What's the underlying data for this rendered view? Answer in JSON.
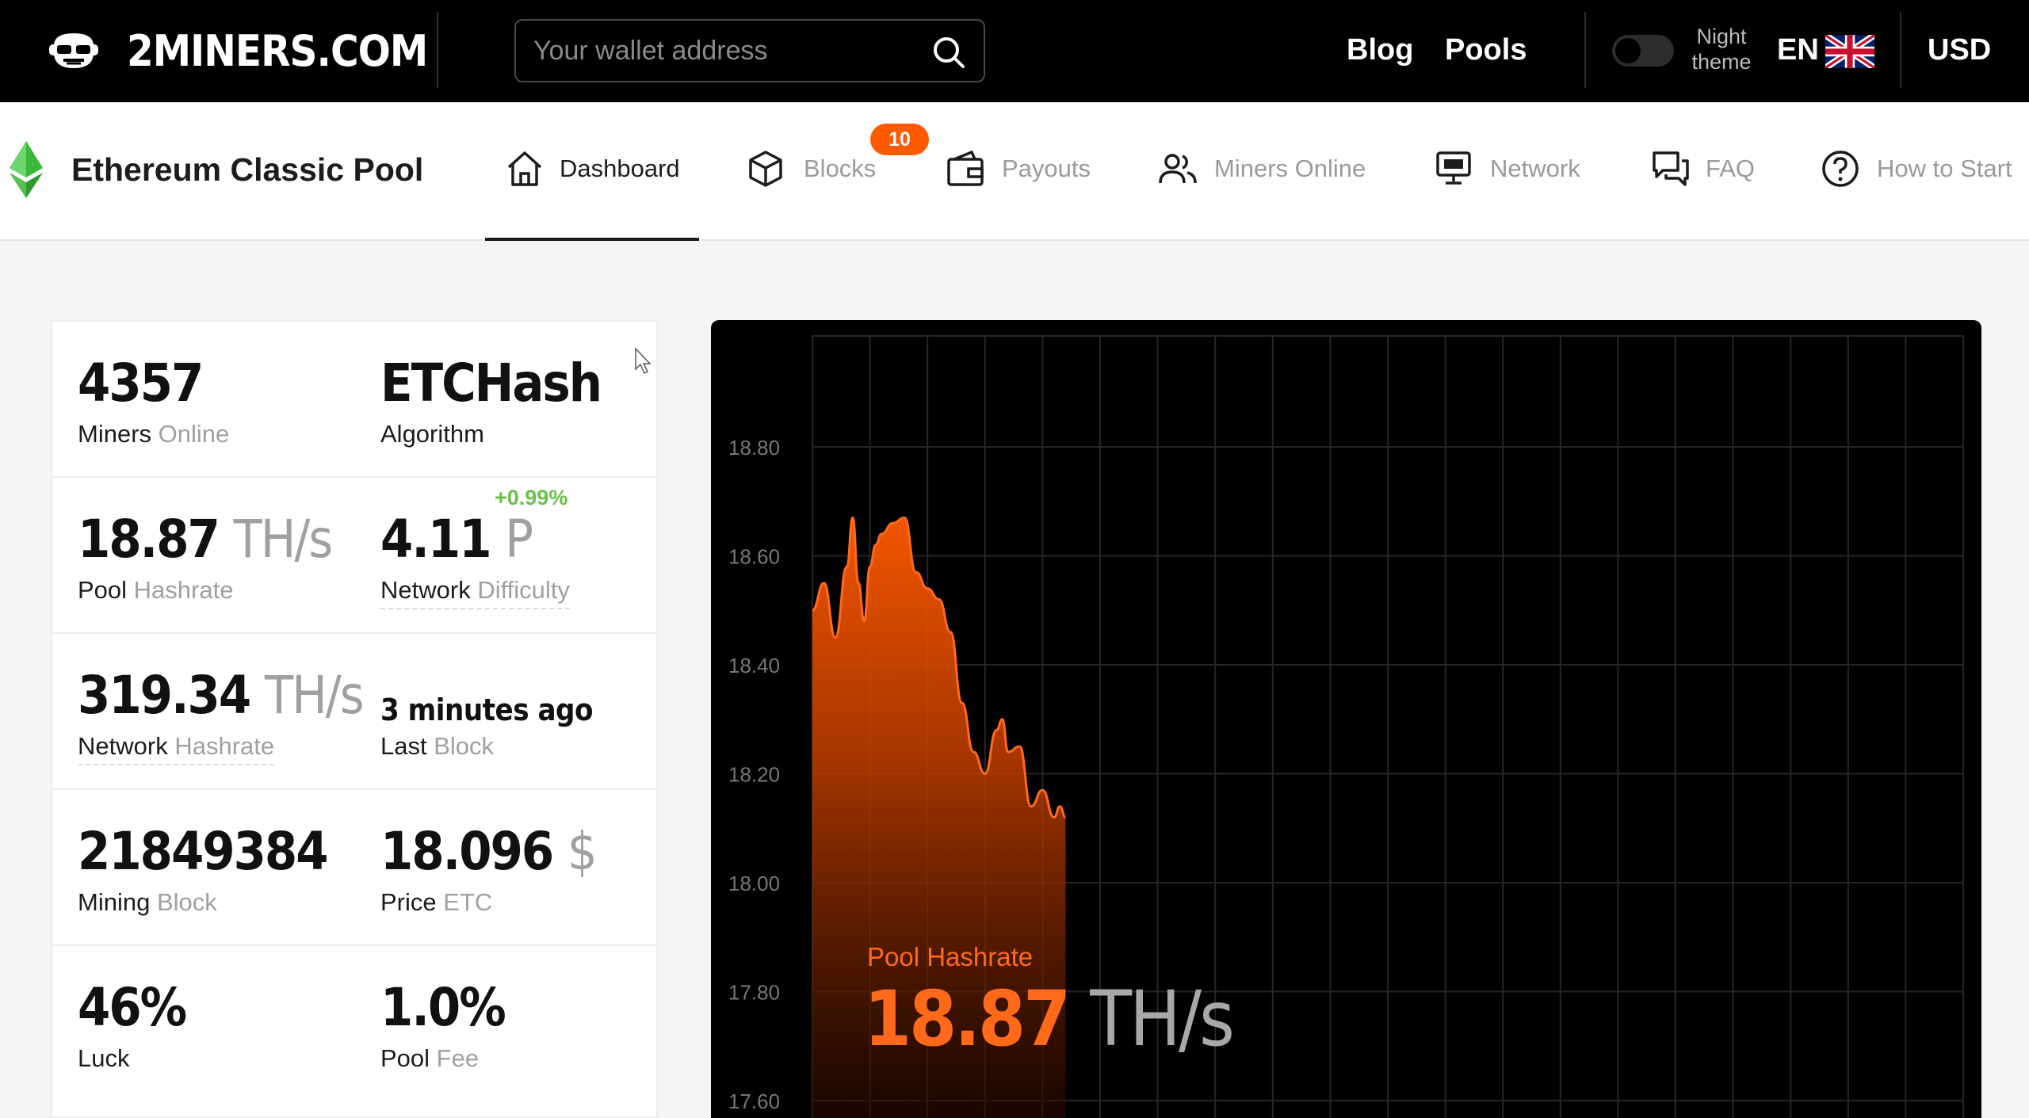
{
  "header": {
    "logo_text": "2MINERS.COM",
    "search": {
      "placeholder": "Your wallet address"
    },
    "links": [
      {
        "label": "Blog"
      },
      {
        "label": "Pools"
      }
    ],
    "night_theme": {
      "line1": "Night",
      "line2": "theme",
      "enabled": false
    },
    "language": "EN",
    "currency": "USD"
  },
  "subnav": {
    "pool_title": "Ethereum Classic Pool",
    "tabs": [
      {
        "label": "Dashboard",
        "icon": "home-icon",
        "active": true
      },
      {
        "label": "Blocks",
        "icon": "cube-icon",
        "badge": "10"
      },
      {
        "label": "Payouts",
        "icon": "wallet-icon"
      },
      {
        "label": "Miners Online",
        "icon": "users-icon"
      },
      {
        "label": "Network",
        "icon": "monitor-icon"
      },
      {
        "label": "FAQ",
        "icon": "chat-icon"
      },
      {
        "label": "How to Start",
        "icon": "question-icon"
      }
    ]
  },
  "stats": {
    "miners_online": {
      "value": "4357",
      "label": "Miners",
      "label_muted": "Online"
    },
    "algorithm": {
      "value": "ETCHash",
      "label": "Algorithm"
    },
    "pool_hashrate": {
      "value": "18.87",
      "unit": "TH/s",
      "label": "Pool",
      "label_muted": "Hashrate"
    },
    "network_difficulty": {
      "value": "4.11",
      "unit": "P",
      "label": "Network",
      "label_muted": "Difficulty"
    },
    "network_hashrate": {
      "value": "319.34",
      "unit": "TH/s",
      "label": "Network",
      "label_muted": "Hashrate"
    },
    "last_block": {
      "value": "3 minutes ago",
      "label": "Last",
      "label_muted": "Block"
    },
    "mining_block": {
      "value": "21849384",
      "label": "Mining",
      "label_muted": "Block"
    },
    "price": {
      "value": "18.096",
      "unit": "$",
      "change": "+0.99%",
      "label": "Price",
      "label_muted": "ETC"
    },
    "luck": {
      "value": "46%",
      "label": "Luck"
    },
    "pool_fee": {
      "value": "1.0%",
      "label": "Pool",
      "label_muted": "Fee"
    }
  },
  "chart_data": {
    "type": "area",
    "title": "Pool Hashrate",
    "current_value": "18.87",
    "current_unit": "TH/s",
    "ylim": [
      17.6,
      18.95
    ],
    "y_ticks": [
      17.6,
      17.8,
      18.0,
      18.2,
      18.4,
      18.6,
      18.8
    ],
    "y_tick_labels": [
      "17.60",
      "17.80",
      "18.00",
      "18.20",
      "18.40",
      "18.60",
      "18.80"
    ],
    "grid": true,
    "x": [
      0,
      0.01,
      0.02,
      0.03,
      0.035,
      0.04,
      0.045,
      0.05,
      0.055,
      0.06,
      0.07,
      0.08,
      0.09,
      0.1,
      0.11,
      0.12,
      0.13,
      0.14,
      0.15,
      0.16,
      0.165,
      0.17,
      0.18,
      0.19,
      0.2,
      0.21,
      0.215,
      0.22
    ],
    "series": [
      {
        "color": "#ff6a1a",
        "values": [
          18.5,
          18.55,
          18.45,
          18.58,
          18.67,
          18.55,
          18.48,
          18.58,
          18.62,
          18.64,
          18.66,
          18.67,
          18.57,
          18.54,
          18.52,
          18.46,
          18.33,
          18.24,
          18.2,
          18.28,
          18.3,
          18.24,
          18.25,
          18.14,
          18.17,
          18.12,
          18.14,
          18.12
        ]
      }
    ]
  },
  "colors": {
    "accent": "#ff6a1a",
    "badge": "#ff5a00",
    "positive": "#6cc04a",
    "etc_green": "#3ab83a"
  }
}
